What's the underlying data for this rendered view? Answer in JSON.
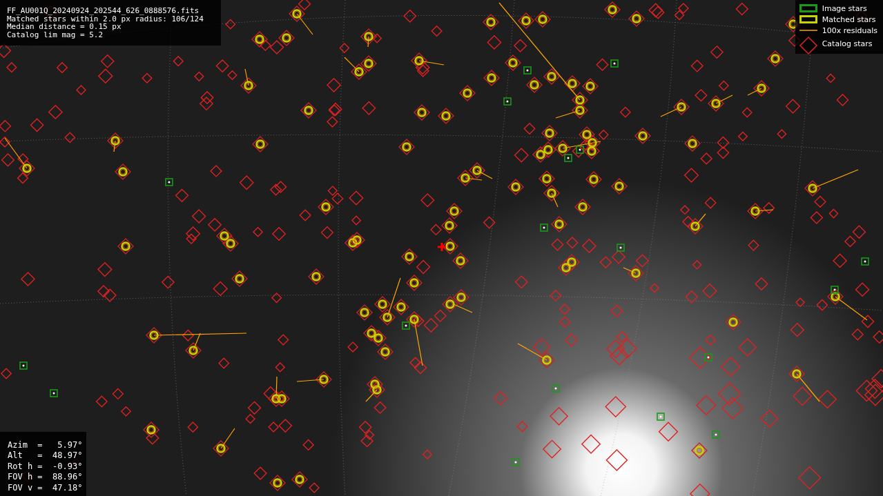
{
  "header": [
    "FF_AU001Q_20240924_202544_626_0888576.fits",
    "Matched stars within 2.0 px radius: 106/124",
    "Median distance = 0.15 px",
    "Catalog lim mag = 5.2"
  ],
  "legend": [
    {
      "kind": "image",
      "label": "Image stars"
    },
    {
      "kind": "matched",
      "label": "Matched stars"
    },
    {
      "kind": "residual",
      "label": "100x residuals"
    },
    {
      "kind": "catalog",
      "label": "Catalog stars"
    }
  ],
  "pointing": [
    "Azim  =   5.97°",
    "Alt   =  48.97°",
    "Rot h =  -0.93°",
    "FOV h =  88.96°",
    "FOV v =  47.18°"
  ]
}
